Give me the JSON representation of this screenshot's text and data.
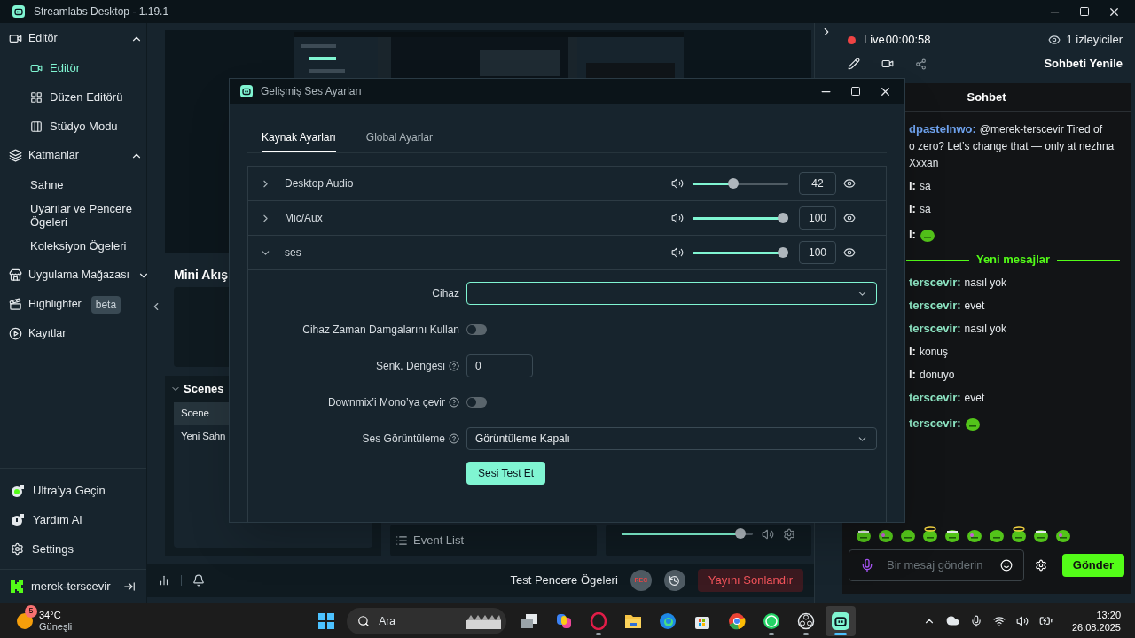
{
  "app_window": {
    "title": "Streamlabs Desktop - 1.19.1"
  },
  "sidebar": {
    "sections": [
      {
        "label": "Editör",
        "expanded": true,
        "children": [
          {
            "label": "Editör",
            "selected": true
          },
          {
            "label": "Düzen Editörü",
            "selected": false
          },
          {
            "label": "Stüdyo Modu",
            "selected": false
          }
        ]
      },
      {
        "label": "Katmanlar",
        "expanded": true,
        "children": [
          {
            "label": "Sahne",
            "selected": false
          },
          {
            "label": "Uyarılar ve Pencere Ögeleri",
            "selected": false
          },
          {
            "label": "Koleksiyon Ögeleri",
            "selected": false
          }
        ]
      },
      {
        "label": "Uygulama Mağazası",
        "expanded": false
      },
      {
        "label": "Highlighter",
        "badge": "beta"
      },
      {
        "label": "Kayıtlar"
      }
    ],
    "footer": [
      {
        "label": "Ultra’ya Geçin"
      },
      {
        "label": "Yardım Al"
      },
      {
        "label": "Settings"
      }
    ],
    "user": {
      "name": "merek-terscevir"
    }
  },
  "editor": {
    "mini_feed": {
      "title": "Mini Akış"
    },
    "scenes": {
      "title": "Scenes",
      "expanded": true,
      "items": [
        {
          "label": "Scene",
          "selected": true
        },
        {
          "label": "Yeni Sahn",
          "selected": false
        }
      ]
    },
    "event_list": {
      "title": "Event List"
    },
    "mixer": {
      "level": 0.94
    }
  },
  "bottom_bar": {
    "test_label": "Test Pencere Ögeleri",
    "rec": "REC",
    "end_stream": "Yayını Sonlandır"
  },
  "dialog": {
    "title": "Gelişmiş Ses Ayarları",
    "tabs": [
      {
        "label": "Kaynak Ayarları",
        "selected": true
      },
      {
        "label": "Global Ayarlar",
        "selected": false
      }
    ],
    "sources": [
      {
        "name": "Desktop Audio",
        "expanded": false,
        "level": 0.42,
        "reading": "42"
      },
      {
        "name": "Mic/Aux",
        "expanded": false,
        "level": 1,
        "reading": "100"
      },
      {
        "name": "ses",
        "expanded": true,
        "level": 1,
        "reading": "100"
      }
    ],
    "settings": [
      {
        "kind": "select",
        "label": "Cihaz",
        "help": false,
        "focused": true
      },
      {
        "kind": "toggle",
        "label": "Cihaz Zaman Damgalarını Kullan",
        "help": false,
        "on": false
      },
      {
        "kind": "number",
        "label": "Senk. Dengesi",
        "help": true,
        "value": "0"
      },
      {
        "kind": "toggle",
        "label": "Downmix’i Mono’ya çevir",
        "help": true,
        "on": false
      },
      {
        "kind": "select",
        "label": "Ses Görüntüleme",
        "help": true,
        "focused": false,
        "value": "Görüntüleme Kapalı"
      }
    ],
    "test_button": "Sesi Test Et"
  },
  "chat": {
    "live": "Live",
    "timer": "00:00:58",
    "viewers": "1 izleyiciler",
    "refresh": "Sohbeti Yenile",
    "title": "Sohbet",
    "messages": [
      {
        "kind": "text",
        "author": "dpastelnwo:",
        "color": "#6fa3ef",
        "lines": [
          "@merek-terscevir Tired of",
          "o zero? Let’s change that — only at nezhna",
          "Xxxan"
        ]
      },
      {
        "kind": "text",
        "author": "l:",
        "lines": [
          "sa"
        ]
      },
      {
        "kind": "text",
        "author": "l:",
        "lines": [
          "sa"
        ]
      },
      {
        "kind": "emote",
        "author": "l:"
      },
      {
        "kind": "divider",
        "text": "Yeni mesajlar"
      },
      {
        "kind": "text",
        "author": "terscevir:",
        "color": "#8ee6c4",
        "lines": [
          "nasıl yok"
        ]
      },
      {
        "kind": "text",
        "author": "terscevir:",
        "color": "#8ee6c4",
        "lines": [
          "evet"
        ]
      },
      {
        "kind": "text",
        "author": "terscevir:",
        "color": "#8ee6c4",
        "lines": [
          "nasıl yok"
        ]
      },
      {
        "kind": "text",
        "author": "l:",
        "lines": [
          "konuş"
        ]
      },
      {
        "kind": "text",
        "author": "l:",
        "lines": [
          "donuyo"
        ]
      },
      {
        "kind": "text",
        "author": "terscevir:",
        "color": "#8ee6c4",
        "lines": [
          "evet"
        ]
      },
      {
        "kind": "emote",
        "author": "terscevir:",
        "color": "#8ee6c4"
      }
    ],
    "input": {
      "placeholder": "Bir mesaj gönderin"
    },
    "send": "Gönder"
  },
  "taskbar": {
    "weather": {
      "badge": "5",
      "temp": "34°C",
      "condition": "Güneşli"
    },
    "search": {
      "placeholder": "Ara"
    },
    "apps": [
      {
        "kind": "start",
        "selected": false,
        "running": false
      },
      {
        "kind": "taskview",
        "selected": false,
        "running": false
      },
      {
        "kind": "copilot",
        "selected": false,
        "running": false
      },
      {
        "kind": "ring",
        "selected": false,
        "running": true
      },
      {
        "kind": "folder",
        "selected": false,
        "running": false
      },
      {
        "kind": "edge",
        "selected": false,
        "running": false
      },
      {
        "kind": "store",
        "selected": false,
        "running": false
      },
      {
        "kind": "chrome",
        "selected": false,
        "running": false
      },
      {
        "kind": "whatsapp",
        "selected": false,
        "running": true
      },
      {
        "kind": "obs",
        "selected": false,
        "running": true
      },
      {
        "kind": "streamlabs",
        "selected": true,
        "running": true
      }
    ],
    "clock": {
      "time": "13:20",
      "date": "26.08.2025"
    }
  }
}
